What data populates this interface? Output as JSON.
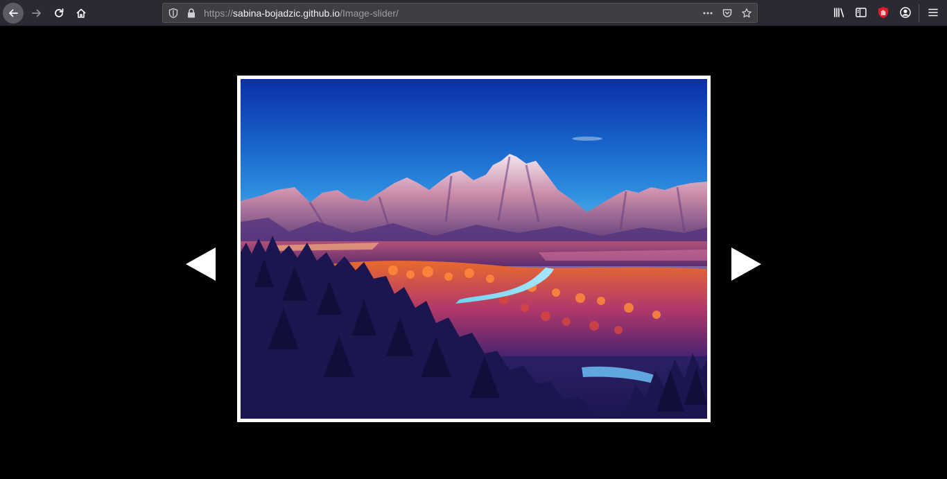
{
  "browser": {
    "url": {
      "scheme": "https://",
      "host": "sabina-bojadzic.github.io",
      "path": "/Image-slider/"
    },
    "nav_icons": [
      "back-arrow-icon",
      "forward-arrow-icon",
      "reload-icon",
      "home-icon"
    ],
    "url_icons": [
      "tracking-shield-icon",
      "lock-icon",
      "more-dots-icon",
      "pocket-icon",
      "bookmark-star-icon"
    ],
    "toolbar_icons": [
      "library-icon",
      "sidebar-icon",
      "ublock-extension-icon",
      "account-icon",
      "hamburger-menu-icon"
    ]
  },
  "slider": {
    "image": "mountain-landscape-icon",
    "prev_icon": "triangle-left-icon",
    "next_icon": "triangle-right-icon"
  },
  "colors": {
    "toolbar_bg": "#2b2a33",
    "urlbar_bg": "#3f3f43",
    "page_bg": "#000000",
    "frame": "#ffffff",
    "extension_red": "#e01b24"
  }
}
